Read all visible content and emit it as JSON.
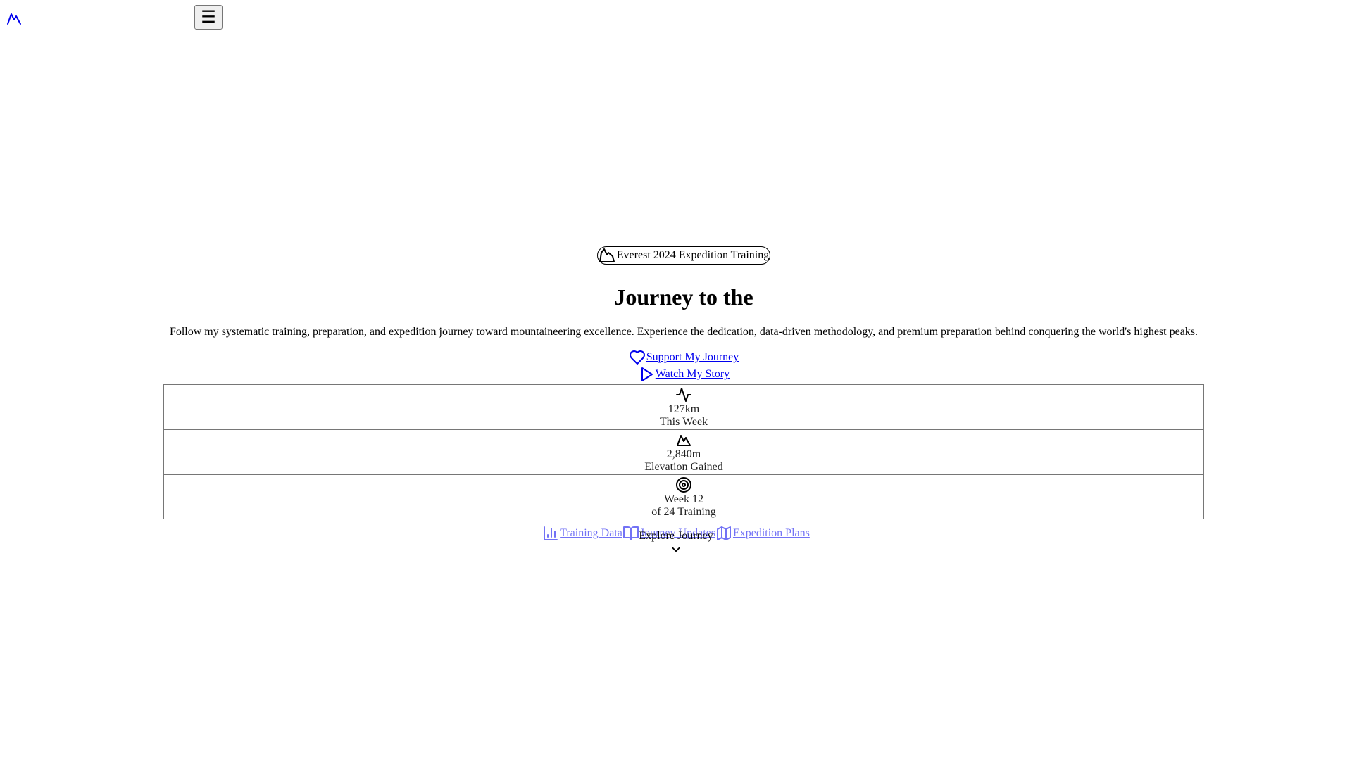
{
  "header": {
    "logo_icon": "mountain-icon",
    "menu_label": "☰",
    "brand_color": "#0000ee"
  },
  "hero": {
    "badge": {
      "icon": "mountain-icon",
      "label": "Everest 2024 Expedition Training"
    },
    "title": "Journey to the",
    "intro": "Follow my systematic training, preparation, and expedition journey toward mountaineering excellence. Experience the dedication, data-driven methodology, and premium preparation behind conquering the world's highest peaks.",
    "ctas": [
      {
        "icon": "heart-icon",
        "label": "Support My Journey"
      },
      {
        "icon": "play-icon",
        "label": "Watch My Story"
      }
    ],
    "stats": [
      {
        "icon": "activity-icon",
        "value": "127km",
        "label": "This Week"
      },
      {
        "icon": "mountain-icon",
        "value": "2,840m",
        "label": "Elevation Gained"
      },
      {
        "icon": "target-icon",
        "value": "Week 12",
        "label": "of 24 Training"
      }
    ]
  },
  "quick_links": [
    {
      "icon": "bar-chart-icon",
      "label": "Training Data"
    },
    {
      "icon": "book-icon",
      "label": "Journey Updates"
    },
    {
      "icon": "map-icon",
      "label": "Expedition Plans"
    }
  ],
  "explore": {
    "label": "Explore Journey",
    "icon": "chevron-down-icon"
  }
}
